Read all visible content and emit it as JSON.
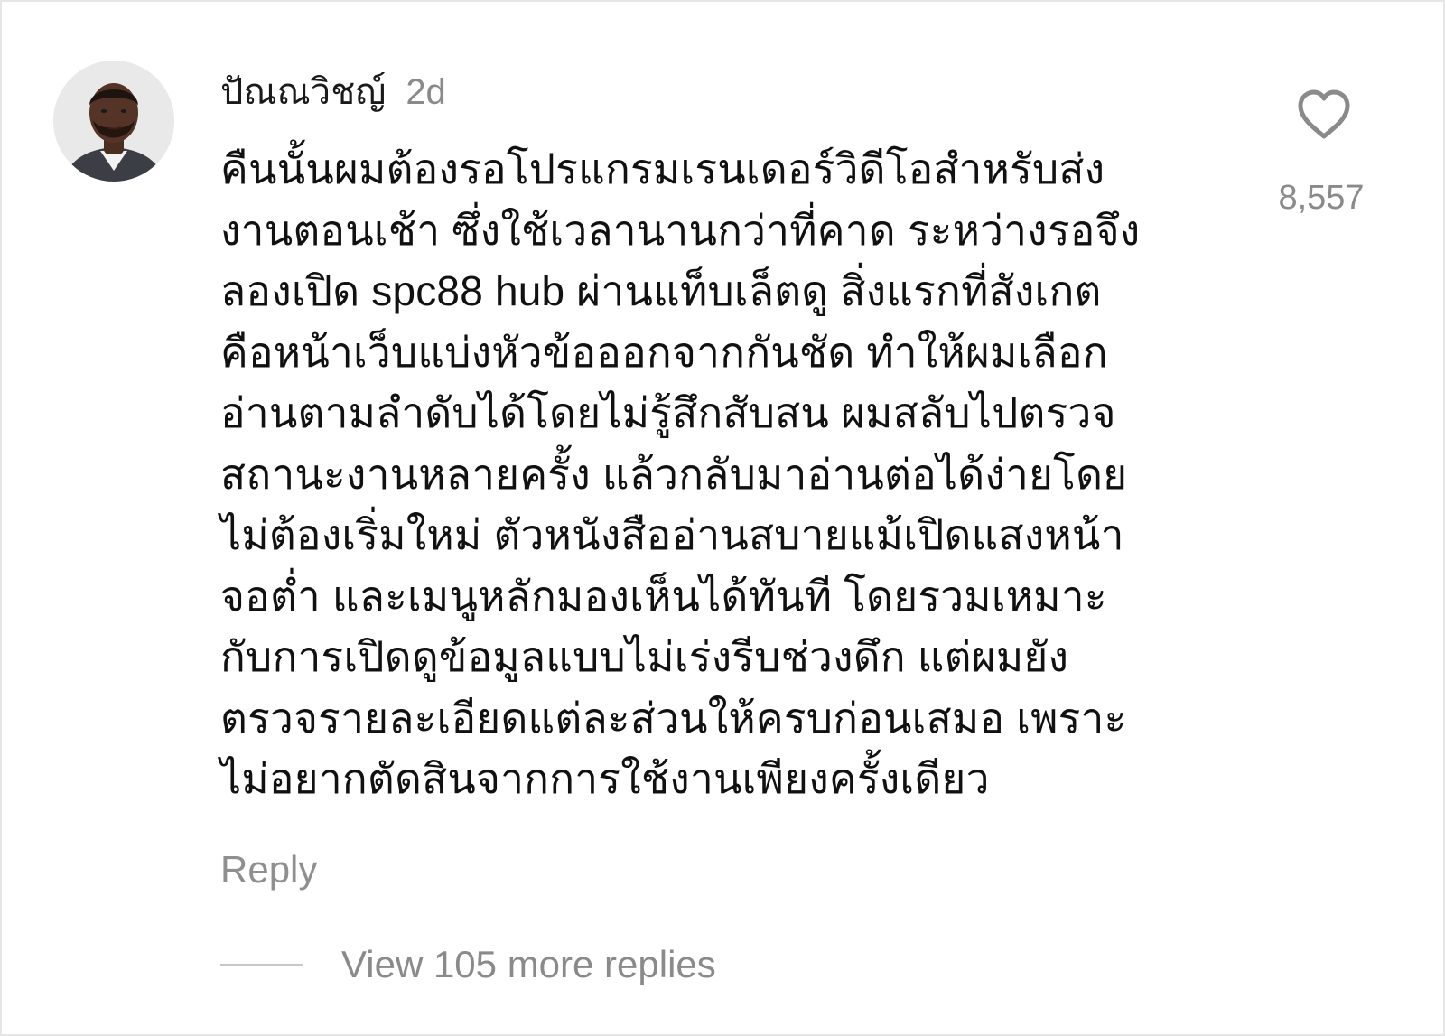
{
  "comment": {
    "username": "ปัณณวิชญ์",
    "timestamp": "2d",
    "text": "คืนนั้นผมต้องรอโปรแกรมเรนเดอร์วิดีโอสำหรับส่ง\nงานตอนเช้า ซึ่งใช้เวลานานกว่าที่คาด ระหว่างรอจึง\nลองเปิด spc88 hub ผ่านแท็บเล็ตดู สิ่งแรกที่สังเกต\nคือหน้าเว็บแบ่งหัวข้อออกจากกันชัด ทำให้ผมเลือก\nอ่านตามลำดับได้โดยไม่รู้สึกสับสน ผมสลับไปตรวจ\nสถานะงานหลายครั้ง แล้วกลับมาอ่านต่อได้ง่ายโดย\nไม่ต้องเริ่มใหม่ ตัวหนังสืออ่านสบายแม้เปิดแสงหน้า\nจอต่ำ และเมนูหลักมองเห็นได้ทันที โดยรวมเหมาะ\nกับการเปิดดูข้อมูลแบบไม่เร่งรีบช่วงดึก แต่ผมยัง\nตรวจรายละเอียดแต่ละส่วนให้ครบก่อนเสมอ เพราะ\nไม่อยากตัดสินจากการใช้งานเพียงครั้งเดียว",
    "reply_label": "Reply",
    "view_replies_label": "View 105 more replies",
    "like_count": "8,557",
    "like_icon": "heart-outline-icon"
  },
  "colors": {
    "primary_text": "#111111",
    "secondary_text": "#8a8a8a",
    "divider": "#c7c7c7",
    "icon": "#8a8a8a"
  }
}
